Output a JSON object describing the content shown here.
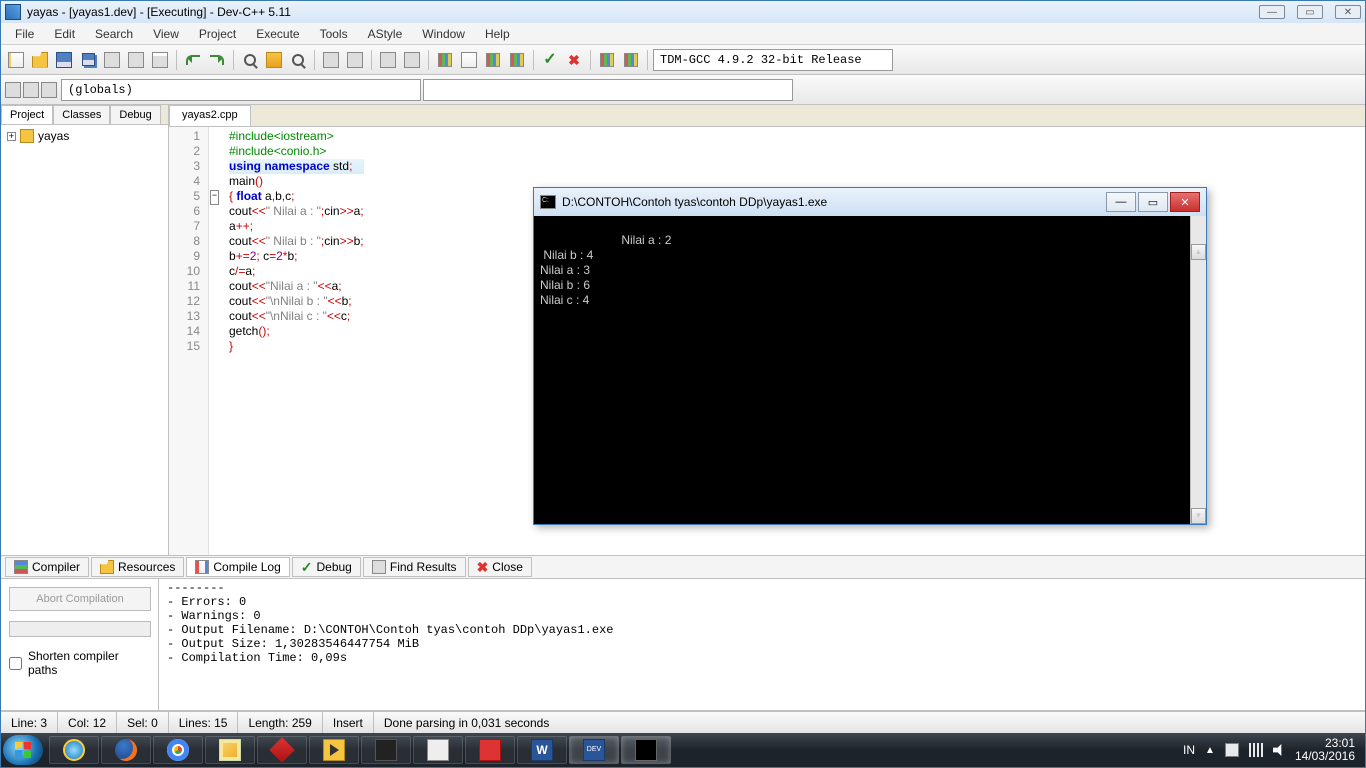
{
  "window": {
    "title": "yayas - [yayas1.dev] - [Executing] - Dev-C++ 5.11"
  },
  "menus": [
    "File",
    "Edit",
    "Search",
    "View",
    "Project",
    "Execute",
    "Tools",
    "AStyle",
    "Window",
    "Help"
  ],
  "compiler_selector": "TDM-GCC 4.9.2 32-bit Release",
  "scope_selector": "(globals)",
  "sidebar": {
    "tabs": [
      "Project",
      "Classes",
      "Debug"
    ],
    "project_name": "yayas"
  },
  "editor": {
    "tab": "yayas2.cpp",
    "lines": [
      {
        "n": "1",
        "html": "<span class='pp'>#include&lt;iostream&gt;</span>"
      },
      {
        "n": "2",
        "html": "<span class='pp'>#include&lt;conio.h&gt;</span>"
      },
      {
        "n": "3",
        "html": "<span class='kw'>using</span> <span class='kw'>namespace</span> std<span class='op'>;</span>",
        "hl": true
      },
      {
        "n": "4",
        "html": "main<span class='op'>()</span>"
      },
      {
        "n": "5",
        "html": "<span class='op'>{</span> <span class='kw'>float</span> a<span class='op'>,</span>b<span class='op'>,</span>c<span class='op'>;</span>",
        "fold": true
      },
      {
        "n": "6",
        "html": "cout<span class='op'>&lt;&lt;</span><span class='str'>\" Nilai a : \"</span><span class='op'>;</span>cin<span class='op'>&gt;&gt;</span>a<span class='op'>;</span>"
      },
      {
        "n": "7",
        "html": "a<span class='op'>++;</span>"
      },
      {
        "n": "8",
        "html": "cout<span class='op'>&lt;&lt;</span><span class='str'>\" Nilai b : \"</span><span class='op'>;</span>cin<span class='op'>&gt;&gt;</span>b<span class='op'>;</span>"
      },
      {
        "n": "9",
        "html": "b<span class='op'>+=</span><span class='num'>2</span><span class='op'>;</span> c<span class='op'>=</span><span class='num'>2</span><span class='op'>*</span>b<span class='op'>;</span>"
      },
      {
        "n": "10",
        "html": "c<span class='op'>/=</span>a<span class='op'>;</span>"
      },
      {
        "n": "11",
        "html": "cout<span class='op'>&lt;&lt;</span><span class='str'>\"Nilai a : \"</span><span class='op'>&lt;&lt;</span>a<span class='op'>;</span>"
      },
      {
        "n": "12",
        "html": "cout<span class='op'>&lt;&lt;</span><span class='str'>\"\\nNilai b : \"</span><span class='op'>&lt;&lt;</span>b<span class='op'>;</span>"
      },
      {
        "n": "13",
        "html": "cout<span class='op'>&lt;&lt;</span><span class='str'>\"\\nNilai c : \"</span><span class='op'>&lt;&lt;</span>c<span class='op'>;</span>"
      },
      {
        "n": "14",
        "html": "getch<span class='op'>();</span>"
      },
      {
        "n": "15",
        "html": "<span class='op'>}</span>"
      }
    ]
  },
  "console": {
    "title": "D:\\CONTOH\\Contoh tyas\\contoh DDp\\yayas1.exe",
    "output": " Nilai a : 2\n Nilai b : 4\nNilai a : 3\nNilai b : 6\nNilai c : 4"
  },
  "bottom_tabs": [
    "Compiler",
    "Resources",
    "Compile Log",
    "Debug",
    "Find Results",
    "Close"
  ],
  "log_panel": {
    "abort": "Abort Compilation",
    "shorten": "Shorten compiler paths",
    "text": "--------\n- Errors: 0\n- Warnings: 0\n- Output Filename: D:\\CONTOH\\Contoh tyas\\contoh DDp\\yayas1.exe\n- Output Size: 1,30283546447754 MiB\n- Compilation Time: 0,09s"
  },
  "status": {
    "line": "Line:   3",
    "col": "Col:   12",
    "sel": "Sel:   0",
    "lines": "Lines:   15",
    "length": "Length:  259",
    "insert": "Insert",
    "done": "Done parsing in 0,031 seconds"
  },
  "tray": {
    "lang": "IN",
    "time": "23:01",
    "date": "14/03/2016"
  }
}
